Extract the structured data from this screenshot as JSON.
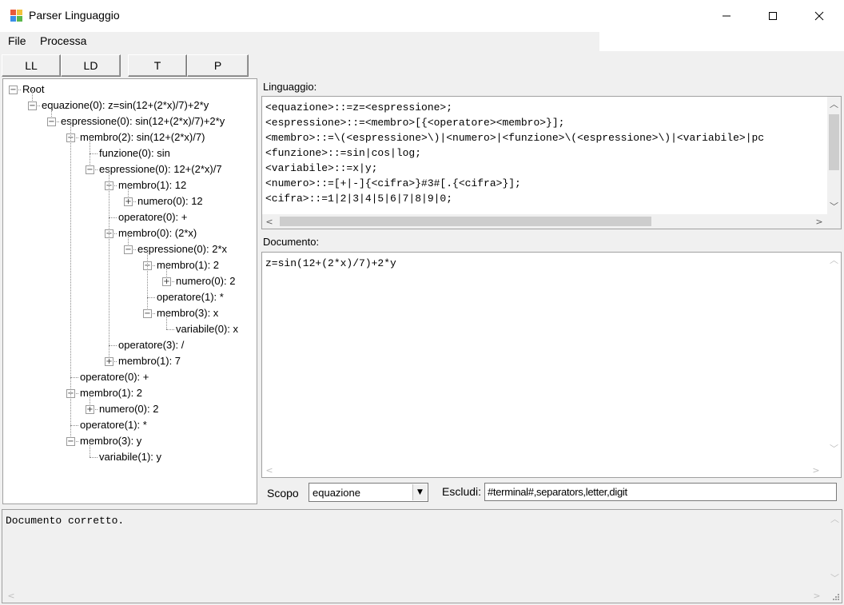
{
  "window": {
    "title": "Parser Linguaggio",
    "icon": "app-icon",
    "controls": {
      "minimize": "—",
      "maximize": "☐",
      "close": "✕"
    }
  },
  "menu": {
    "file": "File",
    "processa": "Processa"
  },
  "toolbar": {
    "ll": "LL",
    "ld": "LD",
    "t": "T",
    "p": "P"
  },
  "tree": {
    "nodes": [
      {
        "label": "Root",
        "box": "−"
      },
      {
        "label": "equazione(0): z=sin(12+(2*x)/7)+2*y",
        "box": "−"
      },
      {
        "label": "espressione(0): sin(12+(2*x)/7)+2*y",
        "box": "−"
      },
      {
        "label": "membro(2): sin(12+(2*x)/7)",
        "box": "−"
      },
      {
        "label": "funzione(0): sin",
        "box": ""
      },
      {
        "label": "espressione(0): 12+(2*x)/7",
        "box": "−"
      },
      {
        "label": "membro(1): 12",
        "box": "−"
      },
      {
        "label": "numero(0): 12",
        "box": "+"
      },
      {
        "label": "operatore(0): +",
        "box": ""
      },
      {
        "label": "membro(0): (2*x)",
        "box": "−"
      },
      {
        "label": "espressione(0): 2*x",
        "box": "−"
      },
      {
        "label": "membro(1): 2",
        "box": "−"
      },
      {
        "label": "numero(0): 2",
        "box": "+"
      },
      {
        "label": "operatore(1): *",
        "box": ""
      },
      {
        "label": "membro(3): x",
        "box": "−"
      },
      {
        "label": "variabile(0): x",
        "box": ""
      },
      {
        "label": "operatore(3): /",
        "box": ""
      },
      {
        "label": "membro(1): 7",
        "box": "+"
      },
      {
        "label": "operatore(0): +",
        "box": ""
      },
      {
        "label": "membro(1): 2",
        "box": "−"
      },
      {
        "label": "numero(0): 2",
        "box": "+"
      },
      {
        "label": "operatore(1): *",
        "box": ""
      },
      {
        "label": "membro(3): y",
        "box": "−"
      },
      {
        "label": "variabile(1): y",
        "box": ""
      }
    ]
  },
  "linguaggio": {
    "label": "Linguaggio:",
    "lines": [
      "<equazione>::=z=<espressione>;",
      "<espressione>::=<membro>[{<operatore><membro>}];",
      "<membro>::=\\(<espressione>\\)|<numero>|<funzione>\\(<espressione>\\)|<variabile>|pc",
      "<funzione>::=sin|cos|log;",
      "<variabile>::=x|y;",
      "<numero>::=[+|-]{<cifra>}#3#[.{<cifra>}];",
      "<cifra>::=1|2|3|4|5|6|7|8|9|0;"
    ]
  },
  "documento": {
    "label": "Documento:",
    "text": "z=sin(12+(2*x)/7)+2*y"
  },
  "scopo": {
    "label": "Scopo",
    "value": "equazione"
  },
  "escludi": {
    "label": "Escludi:",
    "value": "#terminal#,separators,letter,digit"
  },
  "output": {
    "text": "Documento corretto."
  }
}
